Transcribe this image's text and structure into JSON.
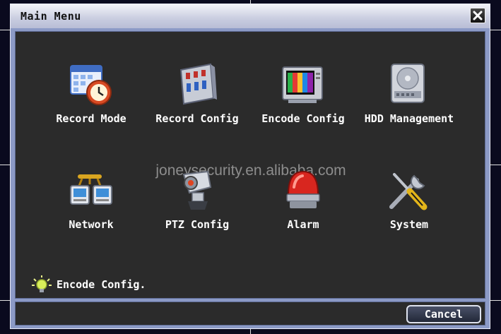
{
  "window": {
    "title": "Main Menu"
  },
  "menu": {
    "items": [
      {
        "label": "Record Mode",
        "icon": "calendar-clock-icon"
      },
      {
        "label": "Record Config",
        "icon": "record-config-icon"
      },
      {
        "label": "Encode Config",
        "icon": "color-monitor-icon"
      },
      {
        "label": "HDD Management",
        "icon": "hard-drive-icon"
      },
      {
        "label": "Network",
        "icon": "network-computers-icon"
      },
      {
        "label": "PTZ Config",
        "icon": "ptz-camera-icon"
      },
      {
        "label": "Alarm",
        "icon": "alarm-siren-icon"
      },
      {
        "label": "System",
        "icon": "tools-icon"
      }
    ]
  },
  "status": {
    "text": "Encode Config.",
    "icon": "lightbulb-icon"
  },
  "watermark": "joneysecurity.en.alibaba.com",
  "footer": {
    "cancel_label": "Cancel"
  },
  "colors": {
    "panel": "#2b2b2b",
    "frame": "#8c9ac6",
    "text": "#ffffff"
  }
}
